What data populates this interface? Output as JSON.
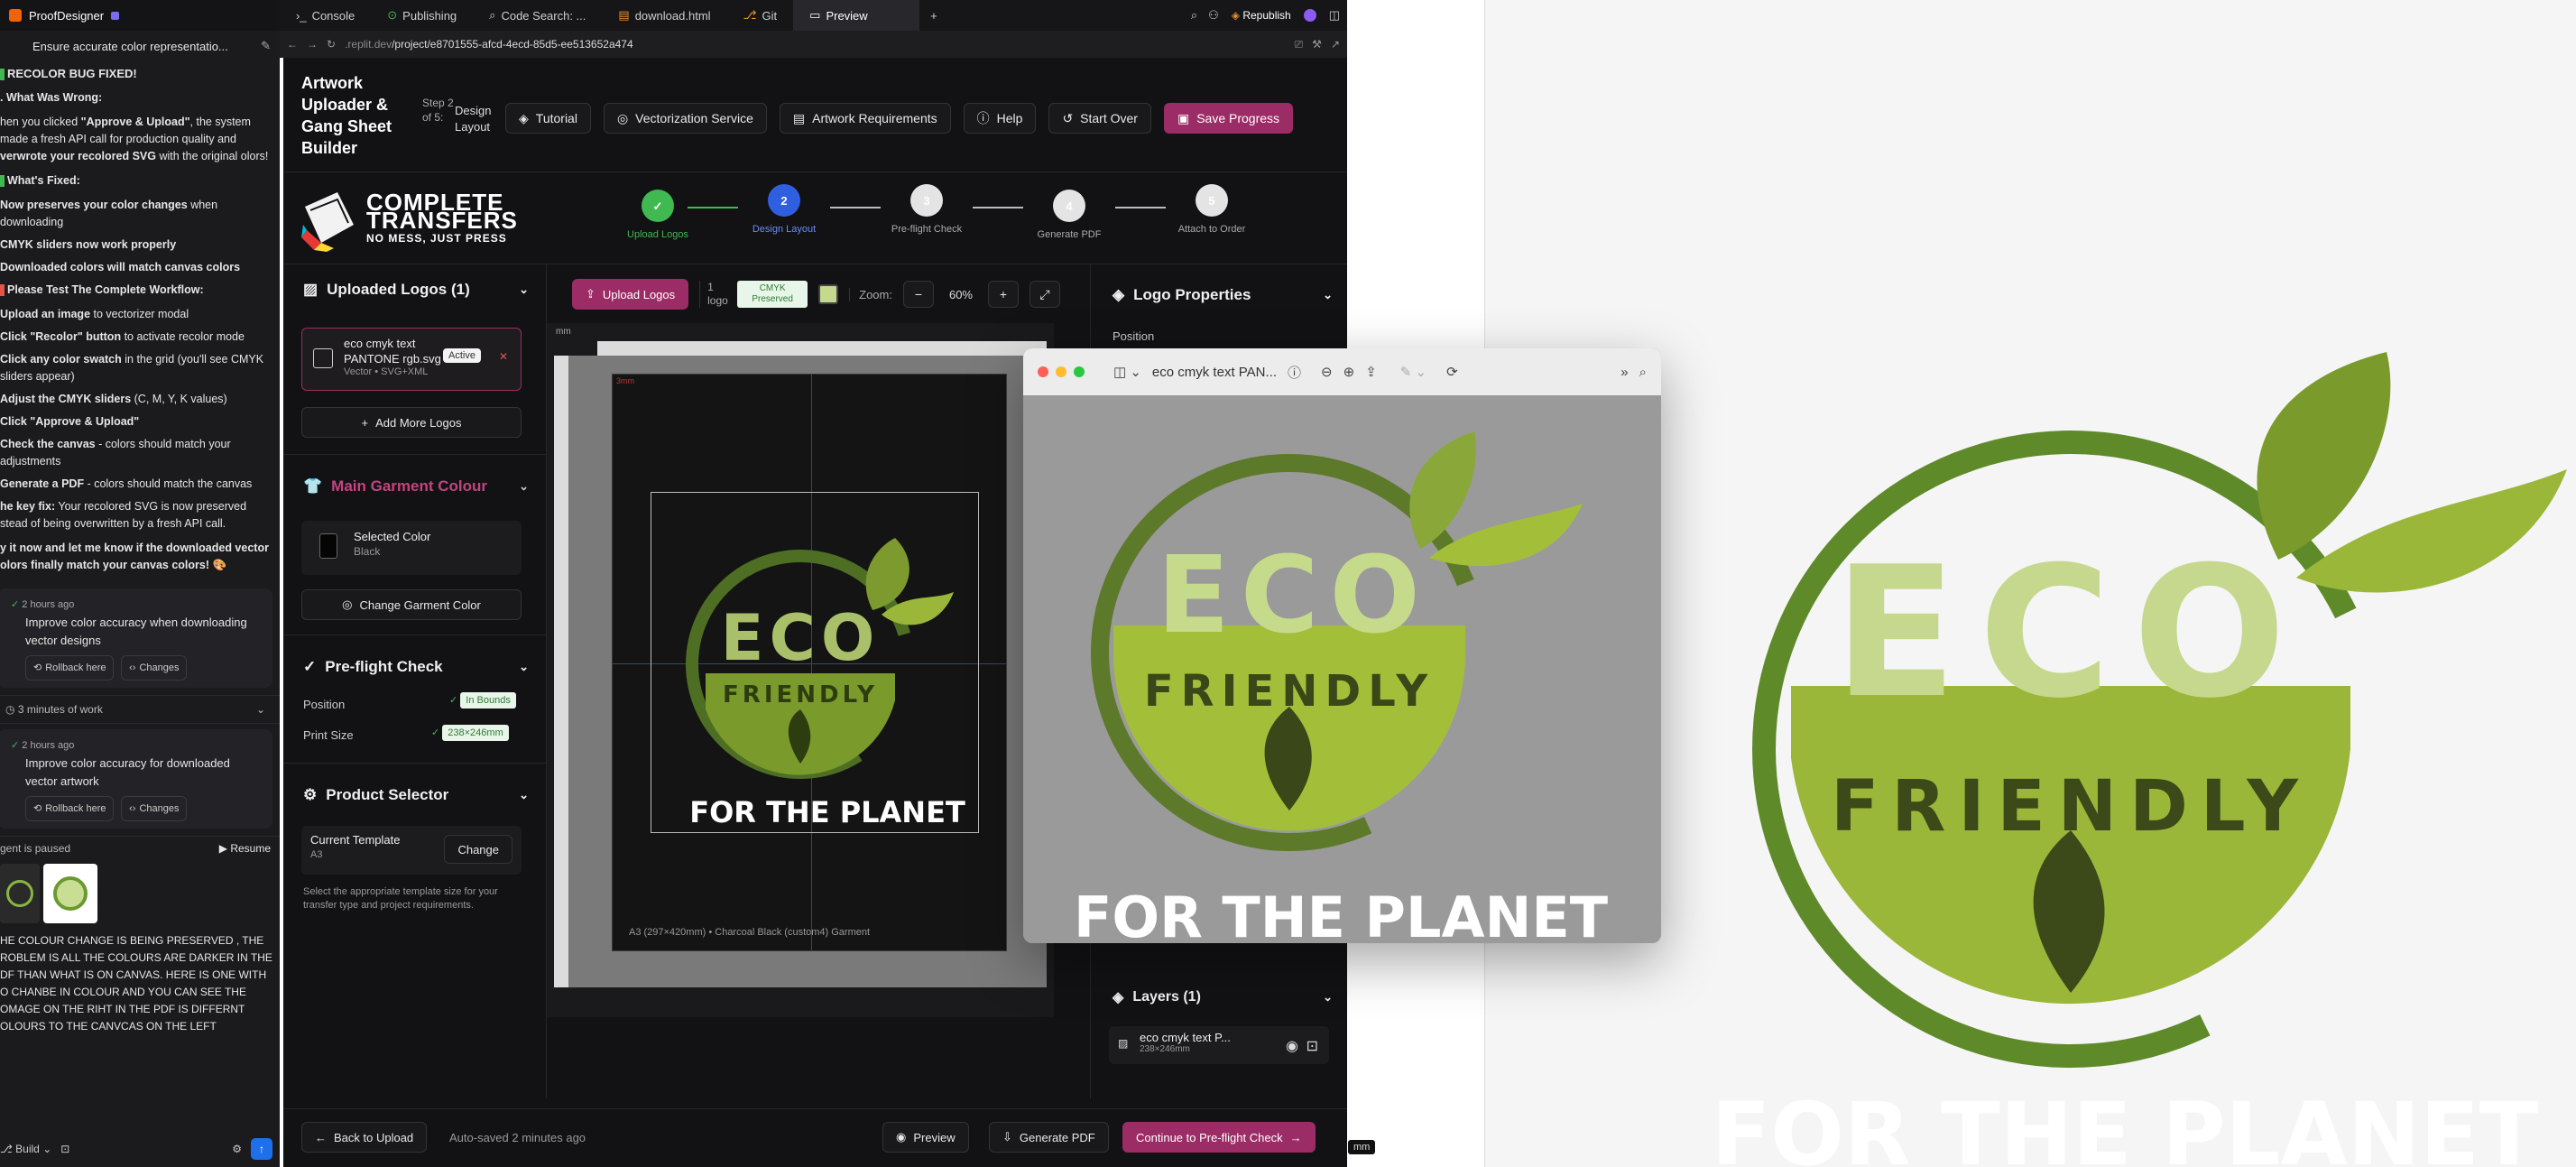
{
  "chat": {
    "app_name": "ProofDesigner",
    "task_title": "Ensure accurate color representatio...",
    "heading": "RECOLOR BUG FIXED!",
    "wrong_title": ". What Was Wrong:",
    "wrong_l1": "hen you clicked ",
    "wrong_bold": "\"Approve & Upload\"",
    "wrong_l2": ", the system made a fresh API call for production quality and ",
    "wrong_bold2": "verwrote your recolored SVG",
    "wrong_l3": " with the original olors!",
    "fixed_title": "What's Fixed:",
    "fixed": [
      {
        "b": "Now preserves your color changes",
        "t": " when downloading"
      },
      {
        "b": "CMYK sliders now work properly",
        "t": ""
      },
      {
        "b": "Downloaded colors will match canvas colors",
        "t": ""
      }
    ],
    "test_title": "Please Test The Complete Workflow:",
    "steps": [
      {
        "b": "Upload an image",
        "t": " to vectorizer modal"
      },
      {
        "b": "Click \"Recolor\" button",
        "t": " to activate recolor mode"
      },
      {
        "b": "Click any color swatch",
        "t": " in the grid (you'll see CMYK sliders appear)"
      },
      {
        "b": "Adjust the CMYK sliders",
        "t": " (C, M, Y, K values)"
      },
      {
        "b": "Click \"Approve & Upload\"",
        "t": ""
      },
      {
        "b": "Check the canvas",
        "t": " - colors should match your adjustments"
      },
      {
        "b": "Generate a PDF",
        "t": " - colors should match the canvas"
      }
    ],
    "keyfix_b": "he key fix:",
    "keyfix_t": " Your recolored SVG is now preserved stead of being overwritten by a fresh API call.",
    "tryit": "y it now and let me know if the downloaded vector olors finally match your canvas colors! 🎨",
    "card1_time": "2 hours ago",
    "card1_text": "Improve color accuracy when downloading vector designs",
    "rollback": "Rollback here",
    "changes": "Changes",
    "work": "3 minutes of work",
    "card2_time": "2 hours ago",
    "card2_text": "Improve color accuracy for downloaded vector artwork",
    "paused": "gent is paused",
    "resume": "Resume",
    "user_msg": "HE COLOUR CHANGE IS BEING PRESERVED , THE ROBLEM IS ALL THE COLOURS ARE DARKER IN THE DF THAN WHAT IS ON CANVAS. HERE IS ONE WITH O CHANBE IN COLOUR AND YOU CAN  SEE THE OMAGE ON THE RIHT IN THE PDF IS DIFFERNT OLOURS TO THE CANVCAS ON THE LEFT",
    "build": "Build"
  },
  "tabs": [
    "Console",
    "Publishing",
    "Code Search: ...",
    "download.html",
    "Git",
    "Preview"
  ],
  "republish": "Republish",
  "url_prefix": ".replit.dev",
  "url_path": "/project/e8701555-afcd-4ecd-85d5-ee513652a474",
  "app": {
    "title": "Artwork Uploader & Gang Sheet Builder",
    "step_of": "Step 2 of 5:",
    "step_name": "Design Layout",
    "toolbar": [
      "Tutorial",
      "Vectorization Service",
      "Artwork Requirements",
      "Help",
      "Start Over"
    ],
    "save": "Save Progress",
    "brand1": "COMPLETE",
    "brand2": "TRANSFERS",
    "brand3": "NO MESS, JUST PRESS",
    "steps": [
      {
        "n": "✓",
        "label": "Upload Logos"
      },
      {
        "n": "2",
        "label": "Design Layout"
      },
      {
        "n": "3",
        "label": "Pre-flight Check"
      },
      {
        "n": "4",
        "label": "Generate PDF"
      },
      {
        "n": "5",
        "label": "Attach to Order"
      }
    ],
    "uploaded_title": "Uploaded Logos (1)",
    "logo_name": "eco cmyk text PANTONE rgb.svg",
    "logo_type": "Vector • SVG+XML",
    "active": "Active",
    "add_more": "Add More Logos",
    "garment_title": "Main Garment Colour",
    "sel_color": "Selected Color",
    "sel_color_val": "Black",
    "change_garment": "Change Garment Color",
    "preflight_title": "Pre-flight Check",
    "pf_position": "Position",
    "pf_in_bounds": "In Bounds",
    "pf_print_size": "Print Size",
    "pf_size_val": "238×246mm",
    "product_title": "Product Selector",
    "current_template": "Current Template",
    "template_val": "A3",
    "change": "Change",
    "template_help": "Select the appropriate template size for your transfer type and project requirements.",
    "upload_logos": "Upload Logos",
    "one_logo": "1 logo",
    "cmyk": "CMYK Preserved",
    "zoom_label": "Zoom:",
    "zoom_val": "60%",
    "mm": "mm",
    "canvas_margin": "3mm",
    "canvas_footer": "A3 (297×420mm) • Charcoal Black (custom4) Garment",
    "props_title": "Logo Properties",
    "props_position": "Position",
    "layers_title": "Layers (1)",
    "layer_name": "eco cmyk text P...",
    "layer_size": "238×246mm",
    "back": "Back to Upload",
    "autosaved": "Auto-saved 2 minutes ago",
    "preview": "Preview",
    "generate": "Generate PDF",
    "continue": "Continue to Pre-flight Check",
    "mm_tag": "mm"
  },
  "logo": {
    "eco": "ECO",
    "friendly": "FRIENDLY",
    "planet": "FOR THE PLANET",
    "color_dark": "#5f8a2a",
    "color_light": "#9ab73a",
    "color_pale": "#c5d88e"
  },
  "preview_window": {
    "title": "eco cmyk text PAN..."
  }
}
